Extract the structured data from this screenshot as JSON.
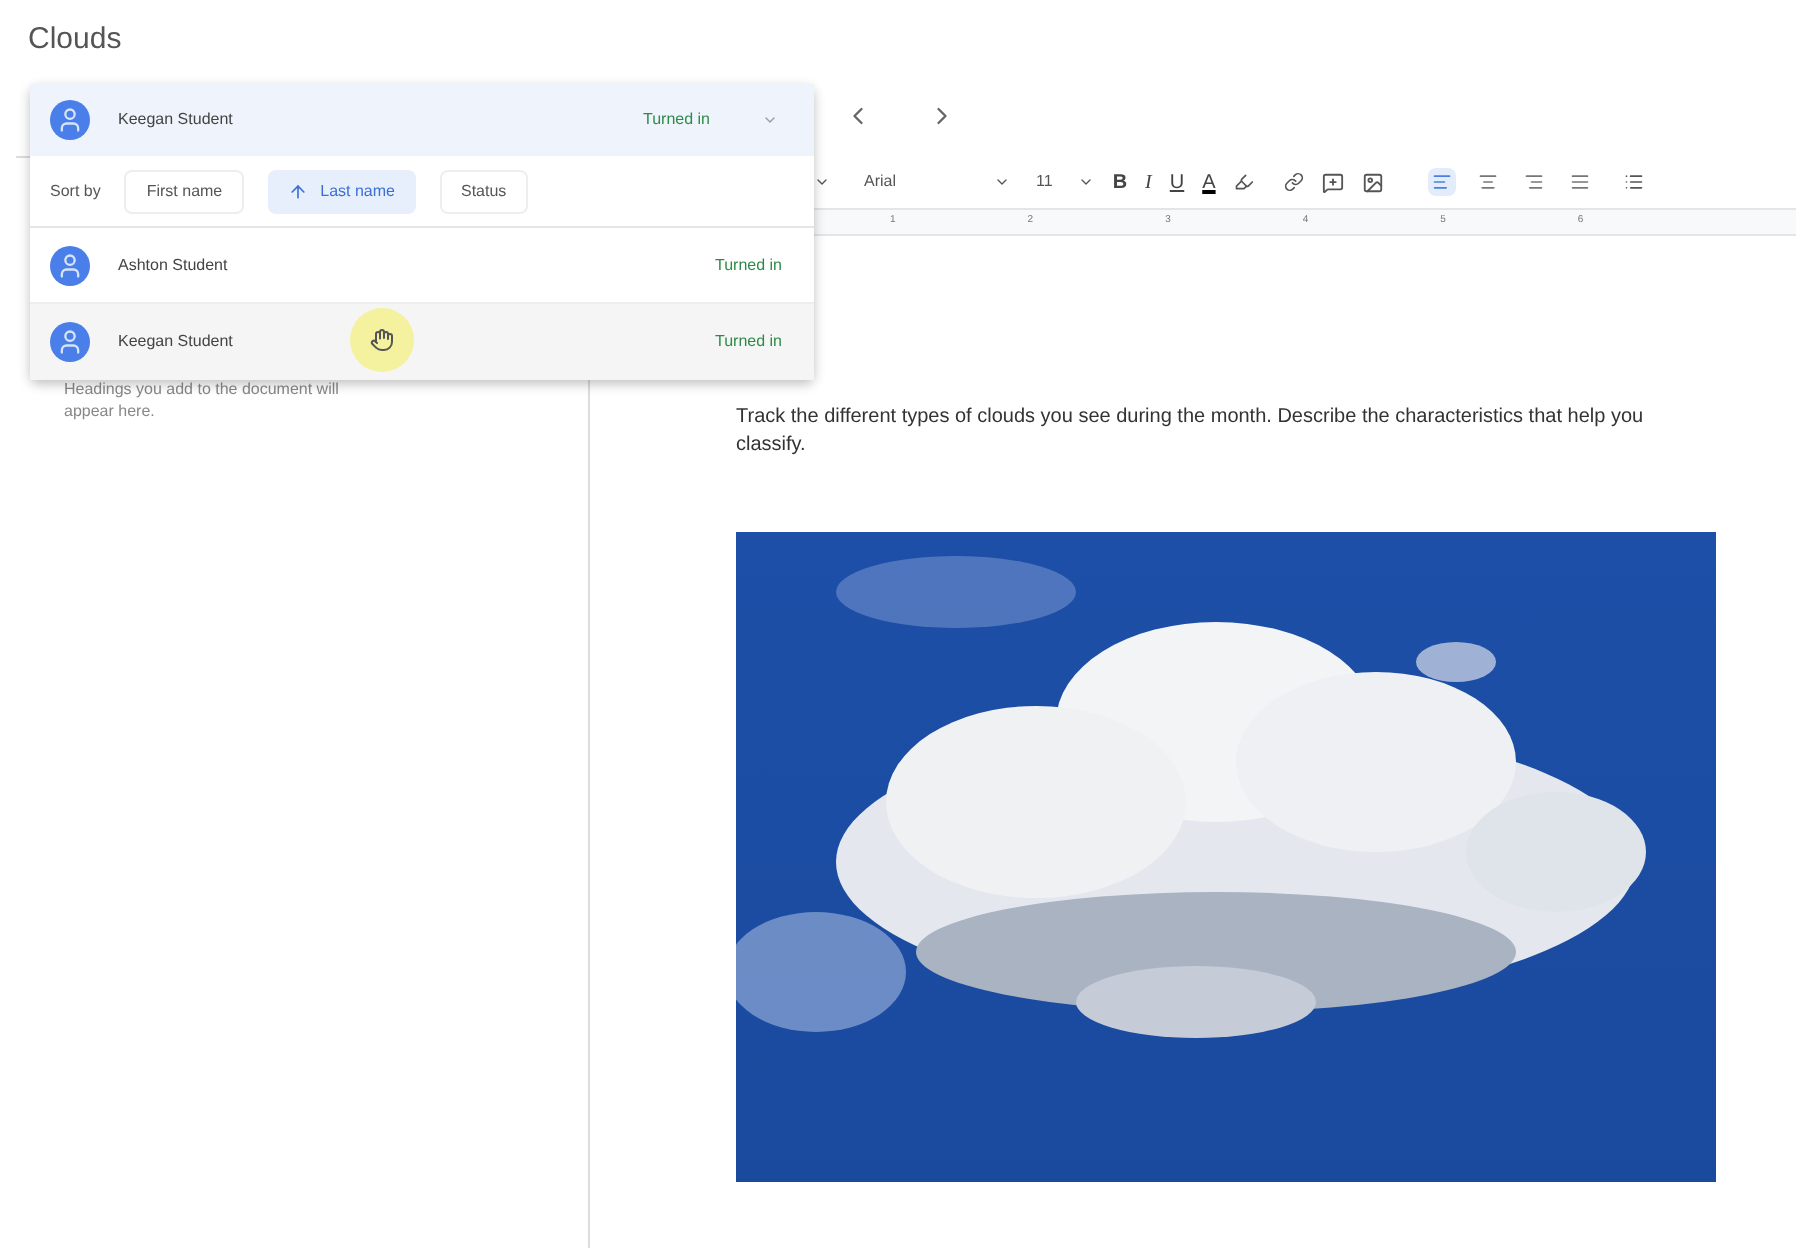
{
  "title": "Clouds",
  "student_picker": {
    "current": {
      "name": "Keegan Student",
      "status": "Turned in"
    },
    "sort_label": "Sort by",
    "sort_options": [
      {
        "label": "First name",
        "selected": false
      },
      {
        "label": "Last name",
        "selected": true
      },
      {
        "label": "Status",
        "selected": false
      }
    ],
    "students": [
      {
        "name": "Ashton Student",
        "status": "Turned in",
        "hovered": false
      },
      {
        "name": "Keegan Student",
        "status": "Turned in",
        "hovered": true
      }
    ]
  },
  "toolbar": {
    "font": "Arial",
    "size": "11",
    "format_buttons": [
      {
        "kind": "bold",
        "label": "B"
      },
      {
        "kind": "italic",
        "label": "I"
      },
      {
        "kind": "underline",
        "label": "U"
      },
      {
        "kind": "text-color",
        "label": "A"
      }
    ],
    "alignment": [
      {
        "kind": "left",
        "selected": true
      },
      {
        "kind": "center",
        "selected": false
      },
      {
        "kind": "right",
        "selected": false
      },
      {
        "kind": "justify",
        "selected": false
      }
    ]
  },
  "ruler": {
    "marks": [
      "1",
      "2",
      "3",
      "4",
      "5",
      "6"
    ]
  },
  "outline": {
    "hint_lines": [
      "Headings you add to the document will",
      "appear here."
    ]
  },
  "document": {
    "text": "Track the different types of clouds you see during the month. Describe the characteristics that help you classify."
  }
}
